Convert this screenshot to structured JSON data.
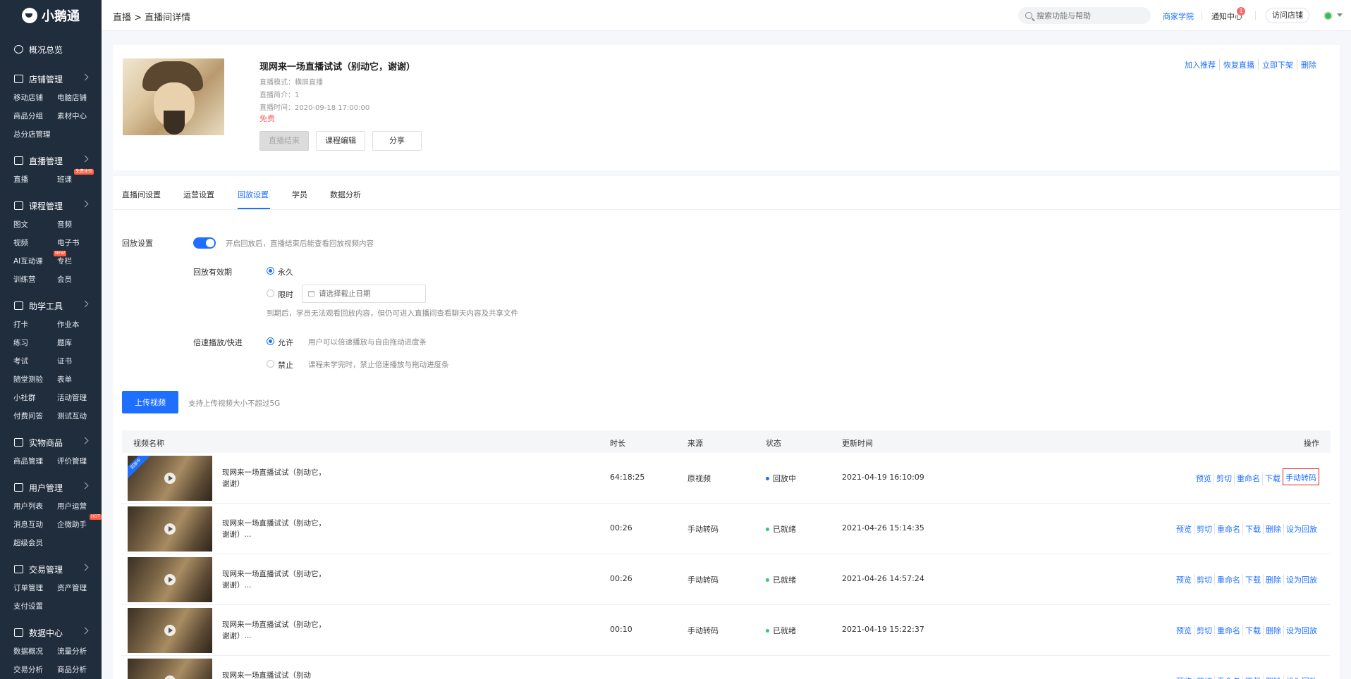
{
  "app": {
    "logo": "小鹅通"
  },
  "sidebar": {
    "overview": "概况总览",
    "groups": [
      {
        "title": "店铺管理",
        "icon": "store-icon",
        "items": [
          "移动店铺",
          "电脑店铺",
          "商品分组",
          "素材中心",
          "总分店管理"
        ]
      },
      {
        "title": "直播管理",
        "icon": "live-icon",
        "items": [
          "直播",
          "班课"
        ],
        "badges": {
          "1": "免费体验"
        }
      },
      {
        "title": "课程管理",
        "icon": "course-icon",
        "items": [
          "图文",
          "音频",
          "视频",
          "电子书",
          "AI互动课",
          "专栏",
          "训练营",
          "会员"
        ],
        "badges": {
          "4": "NEW"
        }
      },
      {
        "title": "助学工具",
        "icon": "tools-icon",
        "items": [
          "打卡",
          "作业本",
          "练习",
          "题库",
          "考试",
          "证书",
          "随堂测验",
          "表单",
          "小社群",
          "活动管理",
          "付费问答",
          "测试互动"
        ]
      },
      {
        "title": "实物商品",
        "icon": "goods-icon",
        "items": [
          "商品管理",
          "评价管理"
        ]
      },
      {
        "title": "用户管理",
        "icon": "user-icon",
        "items": [
          "用户列表",
          "用户运营",
          "消息互动",
          "企微助手",
          "超级会员"
        ],
        "badges": {
          "3": "HOT"
        }
      },
      {
        "title": "交易管理",
        "icon": "trade-icon",
        "items": [
          "订单管理",
          "资产管理",
          "支付设置"
        ]
      },
      {
        "title": "数据中心",
        "icon": "data-icon",
        "items": [
          "数据概况",
          "流量分析",
          "交易分析",
          "商品分析"
        ]
      }
    ]
  },
  "topbar": {
    "breadcrumb": "直播 > 直播间详情",
    "search_placeholder": "搜索功能与帮助",
    "academy": "商家学院",
    "notice": "通知中心",
    "notice_count": "1",
    "visit_store": "访问店铺"
  },
  "course": {
    "title": "现网来一场直播试试（别动它，谢谢）",
    "meta": [
      "直播模式：横屏直播",
      "直播简介：1",
      "直播时间：2020-09-18 17:00:00"
    ],
    "price": "免费",
    "buttons": {
      "ended": "直播结束",
      "edit": "课程编辑",
      "share": "分享"
    },
    "actions": [
      "加入推荐",
      "恢复直播",
      "立即下架",
      "删除"
    ]
  },
  "tabs": [
    "直播间设置",
    "运营设置",
    "回放设置",
    "学员",
    "数据分析"
  ],
  "active_tab": "回放设置",
  "replay": {
    "label": "回放设置",
    "switch_hint": "开启回放后，直播结束后能查看回放视频内容",
    "validity_label": "回放有效期",
    "forever": "永久",
    "limited": "限时",
    "date_placeholder": "请选择截止日期",
    "validity_hint": "到期后，学员无法观看回放内容，但仍可进入直播间查看聊天内容及共享文件",
    "speed_label": "倍速播放/快进",
    "allow": "允许",
    "allow_hint": "用户可以倍速播放与自由拖动进度条",
    "forbid": "禁止",
    "forbid_hint": "课程未学完时，禁止倍速播放与拖动进度条"
  },
  "upload": {
    "button": "上传视频",
    "hint": "支持上传视频大小不超过5G"
  },
  "table": {
    "headers": {
      "name": "视频名称",
      "duration": "时长",
      "source": "来源",
      "status": "状态",
      "updated": "更新时间",
      "ops": "操作"
    },
    "rows": [
      {
        "tag": "回放中",
        "name": "现网来一场直播试试（别动它，谢谢）",
        "duration": "64:18:25",
        "source": "原视频",
        "status": "回放中",
        "updated": "2021-04-19 16:10:09",
        "ops": [
          "预览",
          "剪切",
          "重命名",
          "下载",
          "手动转码"
        ]
      },
      {
        "tag": "",
        "name": "现网来一场直播试试（别动它，谢谢）...",
        "duration": "00:26",
        "source": "手动转码",
        "status": "已就绪",
        "updated": "2021-04-26 15:14:35",
        "ops": [
          "预览",
          "剪切",
          "重命名",
          "下载",
          "删除",
          "设为回放"
        ]
      },
      {
        "tag": "",
        "name": "现网来一场直播试试（别动它，谢谢）...",
        "duration": "00:26",
        "source": "手动转码",
        "status": "已就绪",
        "updated": "2021-04-26 14:57:24",
        "ops": [
          "预览",
          "剪切",
          "重命名",
          "下载",
          "删除",
          "设为回放"
        ]
      },
      {
        "tag": "",
        "name": "现网来一场直播试试（别动它，谢谢）...",
        "duration": "00:10",
        "source": "手动转码",
        "status": "已就绪",
        "updated": "2021-04-19 15:22:37",
        "ops": [
          "预览",
          "剪切",
          "重命名",
          "下载",
          "删除",
          "设为回放"
        ]
      },
      {
        "tag": "",
        "name": "现网来一场直播试试（别动",
        "duration": "",
        "source": "",
        "status": "",
        "updated": "",
        "ops": [
          "预览",
          "剪切",
          "重命名",
          "下载",
          "删除",
          "设为回放"
        ]
      }
    ]
  },
  "colors": {
    "primary": "#1e6fff",
    "sidebar": "#1f2d3d",
    "danger": "#f56c6c",
    "ready": "#2ecc71"
  }
}
